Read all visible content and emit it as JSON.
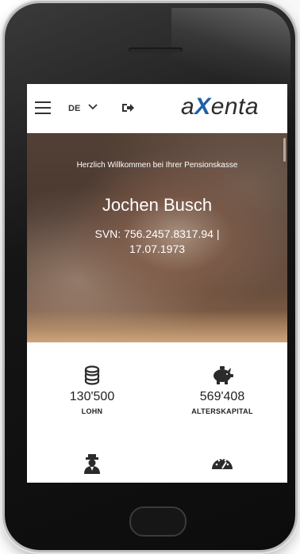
{
  "header": {
    "language": "DE",
    "logo_prefix": "a",
    "logo_x": "X",
    "logo_suffix": "enta"
  },
  "hero": {
    "welcome": "Herzlich Willkommen bei Ihrer Pensionskasse",
    "name": "Jochen Busch",
    "ssn_line1": "SVN: 756.2457.8317.94 |",
    "ssn_line2": "17.07.1973"
  },
  "stats": [
    {
      "icon": "coins-icon",
      "value": "130'500",
      "label": "LOHN"
    },
    {
      "icon": "piggy-bank-icon",
      "value": "569'408",
      "label": "ALTERSKAPITAL"
    },
    {
      "icon": "user-secret-icon",
      "value": "",
      "label": ""
    },
    {
      "icon": "speedometer-icon",
      "value": "",
      "label": ""
    }
  ],
  "colors": {
    "logo_accent": "#1f5fa8",
    "phone_body": "#151515",
    "text_dark": "#222222"
  }
}
